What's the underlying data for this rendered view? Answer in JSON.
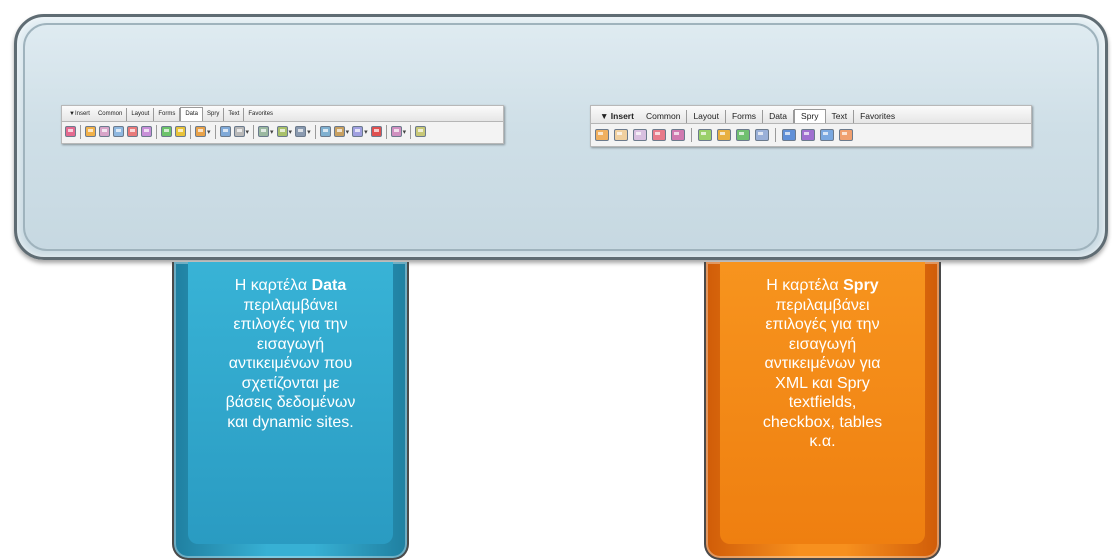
{
  "toolbar_left": {
    "menu_arrow": "▼",
    "tabs": [
      "Insert",
      "Common",
      "Layout",
      "Forms",
      "Data",
      "Spry",
      "Text",
      "Favorites"
    ],
    "active_tab": "Data"
  },
  "toolbar_right": {
    "menu_arrow": "▼",
    "tabs": [
      "Insert",
      "Common",
      "Layout",
      "Forms",
      "Data",
      "Spry",
      "Text",
      "Favorites"
    ],
    "active_tab": "Spry"
  },
  "callout_left": {
    "prefix": "Η καρτέλα ",
    "bold": "Data",
    "lines": [
      "περιλαμβάνει",
      "επιλογές για την",
      "εισαγωγή",
      "αντικειμένων που",
      "σχετίζονται με",
      "βάσεις δεδομένων",
      "και dynamic sites."
    ],
    "color": "#38b3d6"
  },
  "callout_right": {
    "prefix": "Η καρτέλα ",
    "bold": "Spry",
    "lines": [
      "περιλαμβάνει",
      "επιλογές για την",
      "εισαγωγή",
      "αντικειμένων για",
      "XML και Spry",
      "textfields,",
      "checkbox, tables",
      "κ.α."
    ],
    "color": "#f7941e"
  }
}
